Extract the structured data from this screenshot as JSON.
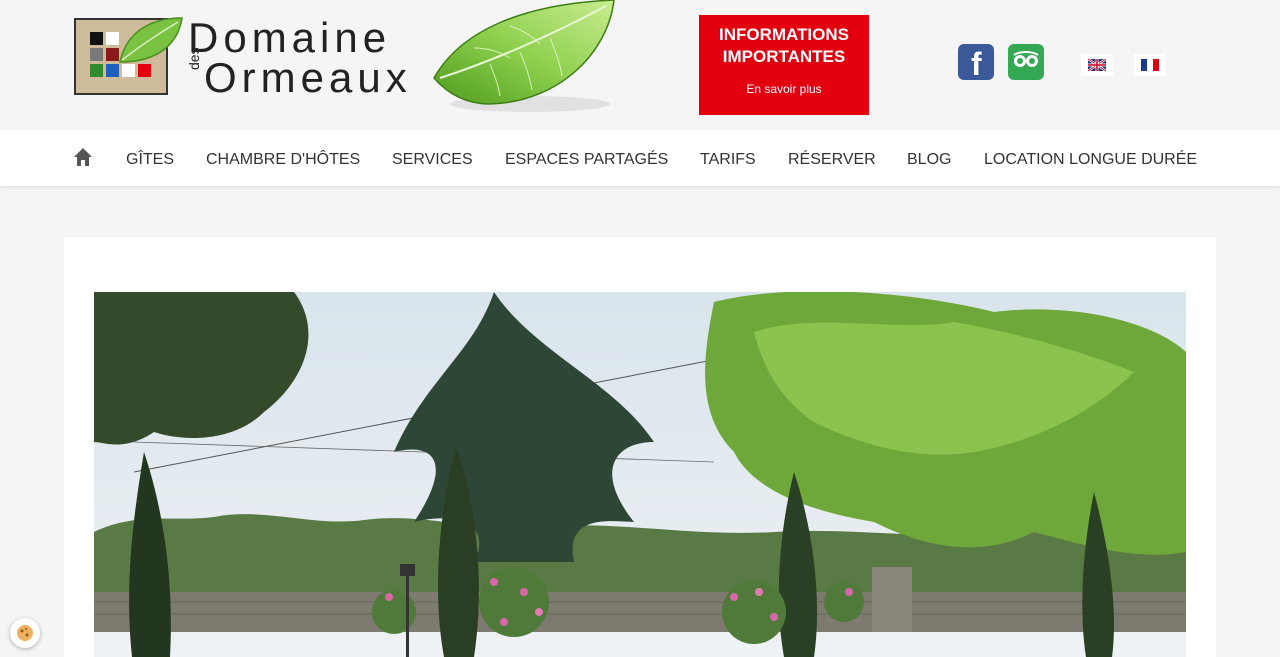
{
  "logo": {
    "line1": "Domaine",
    "des": "des",
    "line2": "Ormeaux",
    "square_colors": [
      "#111111",
      "#ffffff",
      "#7a7a7a",
      "#8b1a1a",
      "#2e8b2e",
      "#1f5fbf",
      "#ffffff",
      "#e2000f"
    ]
  },
  "info_button": {
    "title": "INFORMATIONS IMPORTANTES",
    "subtitle": "En savoir plus"
  },
  "social": {
    "facebook_icon": "facebook-icon",
    "facebook_glyph": "f",
    "tripadvisor_icon": "tripadvisor-icon"
  },
  "languages": [
    "en-flag-icon",
    "fr-flag-icon"
  ],
  "nav": {
    "home_icon": "home-icon",
    "items": [
      "GÎTES",
      "CHAMBRE D'HÔTES",
      "SERVICES",
      "ESPACES PARTAGÉS",
      "TARIFS",
      "RÉSERVER",
      "BLOG",
      "LOCATION LONGUE DURÉE"
    ]
  },
  "colors": {
    "accent_red": "#e2000f",
    "facebook_blue": "#3b5998",
    "tripadvisor_green": "#34a853"
  },
  "cookie_icon": "cookie-icon"
}
